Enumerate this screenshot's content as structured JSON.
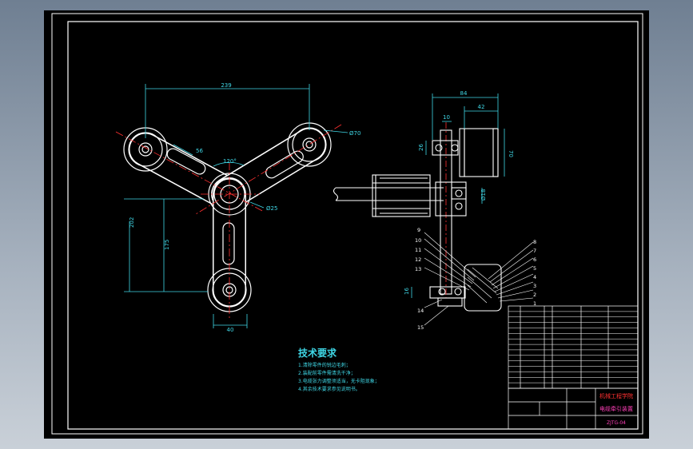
{
  "colors": {
    "background": "#7f8fa1",
    "sheet": "#000000",
    "line": "#ffffff",
    "dimension": "#3fd7e6",
    "centerline": "#ff3030",
    "title_text": "#ff3fb8"
  },
  "front_view": {
    "dims": {
      "span": "239",
      "slot_length": "56",
      "angle": "120°",
      "hub_dia": "Ø25",
      "pulley_dia": "Ø70",
      "height": "202",
      "center_height": "175",
      "arm_width": "40"
    }
  },
  "side_view": {
    "dims": {
      "width": "84",
      "pulley_width": "42",
      "gap": "10",
      "left_dim": "26",
      "right_dim": "70",
      "shaft_dia": "Ø18",
      "bottom_dim": "16"
    },
    "leaders_left": [
      "9",
      "10",
      "11",
      "12",
      "13",
      "14",
      "15"
    ],
    "leaders_right": [
      "8",
      "7",
      "6",
      "5",
      "4",
      "3",
      "2",
      "1"
    ]
  },
  "notes": {
    "title": "技术要求",
    "items": [
      "1.清除零件的锐边毛刺；",
      "2.装配前零件需清洗干净；",
      "3.电缆张力调整须适当，无卡阻现象；",
      "4.其余技术要求参见说明书。"
    ]
  },
  "title_block": {
    "company": "机械工程学院",
    "drawing_name": "电缆牵引装置",
    "drawing_no": "ZJTG-04"
  }
}
